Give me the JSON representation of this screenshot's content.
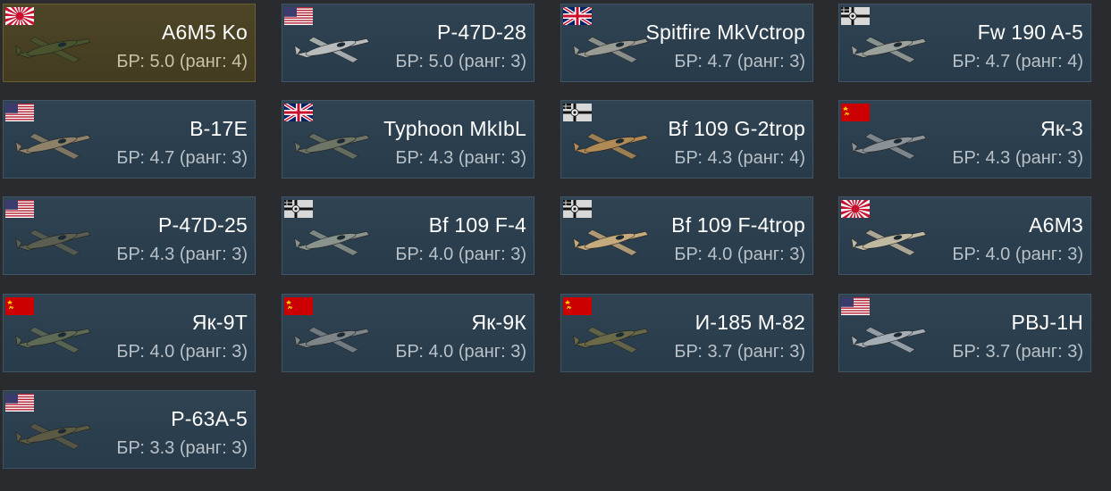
{
  "vehicles": [
    {
      "name": "A6M5 Ko",
      "br": "БР: 5.0 (ранг: 4)",
      "nation": "japan",
      "plane_color": "#49542e",
      "selected": true
    },
    {
      "name": "P-47D-28",
      "br": "БР: 5.0 (ранг: 3)",
      "nation": "usa",
      "plane_color": "#b9bcbd"
    },
    {
      "name": "Spitfire MkVctrop",
      "br": "БР: 4.7 (ранг: 3)",
      "nation": "britain",
      "plane_color": "#9a9c94"
    },
    {
      "name": "Fw 190 A-5",
      "br": "БР: 4.7 (ранг: 4)",
      "nation": "germany",
      "plane_color": "#9aa19b"
    },
    {
      "name": "B-17E",
      "br": "БР: 4.7 (ранг: 3)",
      "nation": "usa",
      "plane_color": "#8d8169"
    },
    {
      "name": "Typhoon MkIbL",
      "br": "БР: 4.3 (ранг: 3)",
      "nation": "britain",
      "plane_color": "#6f7566"
    },
    {
      "name": "Bf 109 G-2trop",
      "br": "БР: 4.3 (ранг: 4)",
      "nation": "germany",
      "plane_color": "#b08a55"
    },
    {
      "name": "Як-3",
      "br": "БР: 4.3 (ранг: 3)",
      "nation": "ussr",
      "plane_color": "#8b9297"
    },
    {
      "name": "P-47D-25",
      "br": "БР: 4.3 (ранг: 3)",
      "nation": "usa",
      "plane_color": "#5a5f52"
    },
    {
      "name": "Bf 109 F-4",
      "br": "БР: 4.0 (ранг: 3)",
      "nation": "germany",
      "plane_color": "#8b938d"
    },
    {
      "name": "Bf 109 F-4trop",
      "br": "БР: 4.0 (ранг: 3)",
      "nation": "germany",
      "plane_color": "#c4aa7c"
    },
    {
      "name": "A6M3",
      "br": "БР: 4.0 (ранг: 3)",
      "nation": "japan",
      "plane_color": "#c0b9a2"
    },
    {
      "name": "Як-9Т",
      "br": "БР: 4.0 (ранг: 3)",
      "nation": "ussr",
      "plane_color": "#5f6a55"
    },
    {
      "name": "Як-9К",
      "br": "БР: 4.0 (ранг: 3)",
      "nation": "ussr",
      "plane_color": "#7d8589"
    },
    {
      "name": "И-185 М-82",
      "br": "БР: 3.7 (ранг: 3)",
      "nation": "ussr",
      "plane_color": "#6a6a48"
    },
    {
      "name": "PBJ-1H",
      "br": "БР: 3.7 (ранг: 3)",
      "nation": "usa",
      "plane_color": "#a5adb4"
    },
    {
      "name": "P-63A-5",
      "br": "БР: 3.3 (ранг: 3)",
      "nation": "usa",
      "plane_color": "#5c5a43"
    }
  ]
}
